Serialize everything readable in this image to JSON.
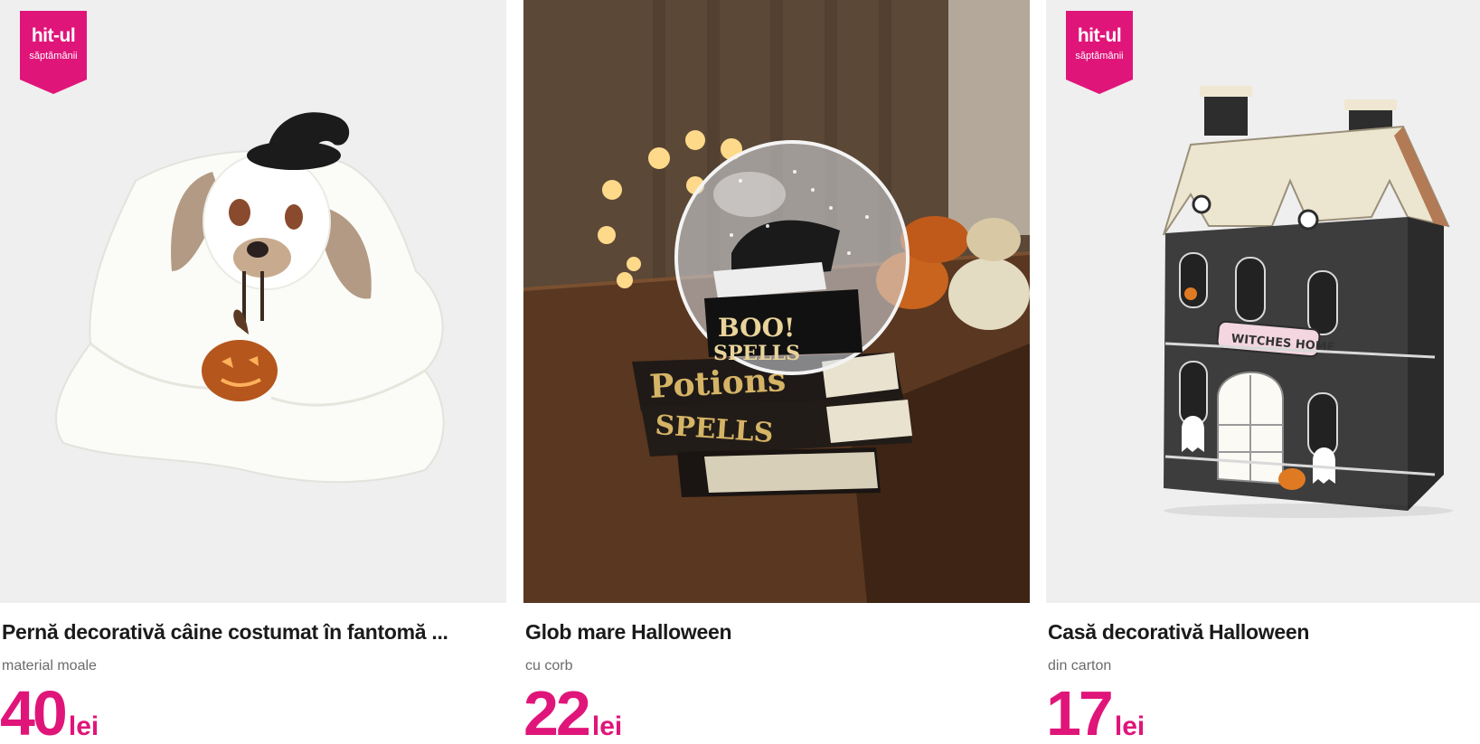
{
  "colors": {
    "brand_pink": "#e0157a",
    "image_bg": "#efefef",
    "title_text": "#1a1a1a",
    "subtitle_text": "#6b6b6b"
  },
  "products": [
    {
      "badge": {
        "title": "hit-ul",
        "subtitle": "săptămânii"
      },
      "image_icon": "ghost-dog-pillow-image",
      "title": "Pernă decorativă câine costumat în fantomă ...",
      "subtitle": "material moale",
      "price": "40",
      "currency": "lei"
    },
    {
      "badge": null,
      "image_icon": "snow-globe-books-image",
      "image_text": [
        "Potions",
        "SPELLS",
        "BOO!",
        "SPELLS"
      ],
      "title": "Glob mare Halloween",
      "subtitle": "cu corb",
      "price": "22",
      "currency": "lei"
    },
    {
      "badge": {
        "title": "hit-ul",
        "subtitle": "săptămânii"
      },
      "image_icon": "cardboard-house-image",
      "image_text": [
        "WITCHES HOME"
      ],
      "title": "Casă decorativă Halloween",
      "subtitle": "din carton",
      "price": "17",
      "currency": "lei"
    }
  ]
}
